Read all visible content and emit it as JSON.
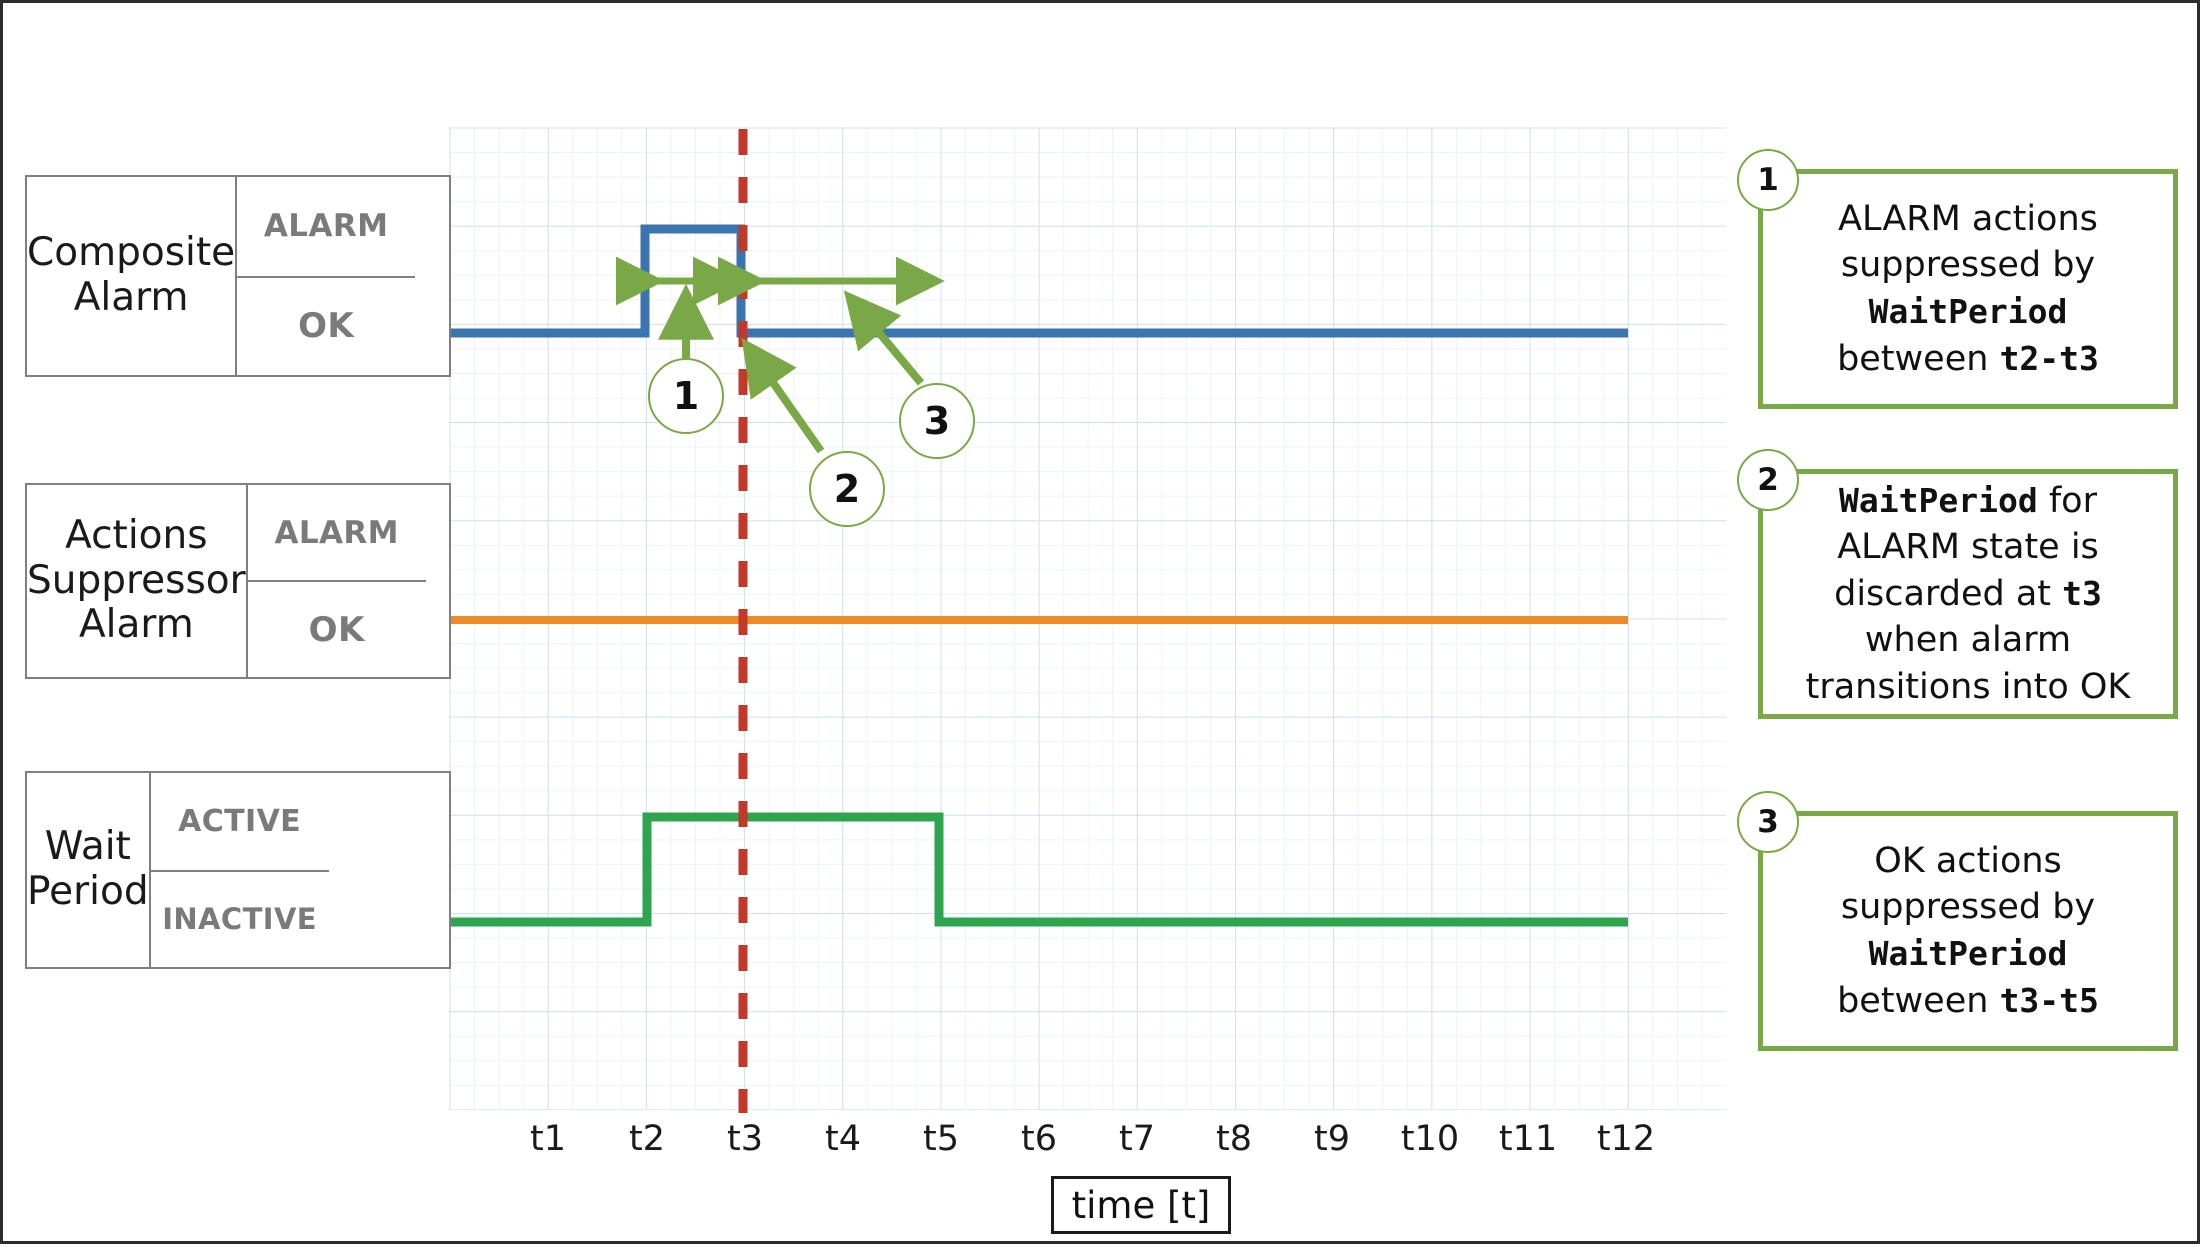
{
  "figure": {
    "axis_title": "time [t]",
    "x_ticks": [
      "t1",
      "t2",
      "t3",
      "t4",
      "t5",
      "t6",
      "t7",
      "t8",
      "t9",
      "t10",
      "t11",
      "t12"
    ]
  },
  "rows": [
    {
      "name": "Composite\nAlarm",
      "name_line1": "Composite",
      "name_line2": "Alarm",
      "state_high": "ALARM",
      "state_low": "OK",
      "color": "#3a75b0"
    },
    {
      "name": "Actions\nSuppressor\nAlarm",
      "name_line1": "Actions",
      "name_line2": "Suppressor",
      "name_line3": "Alarm",
      "state_high": "ALARM",
      "state_low": "OK",
      "color": "#ed8b29"
    },
    {
      "name": "Wait\nPeriod",
      "name_line1": "Wait",
      "name_line2": "Period",
      "state_high": "ACTIVE",
      "state_low": "INACTIVE",
      "color": "#2ea44f"
    }
  ],
  "markers": [
    {
      "id": "1"
    },
    {
      "id": "2"
    },
    {
      "id": "3"
    }
  ],
  "callouts": [
    {
      "id": "1",
      "line1": "ALARM actions",
      "line2": "suppressed by",
      "line3": "WaitPeriod",
      "line4_pre": "between ",
      "line4_mono": "t2-t3"
    },
    {
      "id": "2",
      "line1_mono": "WaitPeriod",
      "line1_post": " for",
      "line2": "ALARM state is",
      "line3_pre": "discarded at ",
      "line3_mono": "t3",
      "line4": "when alarm",
      "line5": "transitions into OK"
    },
    {
      "id": "3",
      "line1": "OK actions",
      "line2": "suppressed by",
      "line3": "WaitPeriod",
      "line4_pre": "between ",
      "line4_mono": "t3-t5"
    }
  ],
  "colors": {
    "composite_alarm": "#3a75b0",
    "suppressor_alarm": "#ed8b29",
    "wait_period": "#2ea44f",
    "marker_line": "#c0392b",
    "annotation": "#7aa846",
    "grid_major": "#cfe2f0",
    "grid_minor": "#eaf4fb",
    "box_border": "#808080"
  },
  "chart_data": {
    "type": "line",
    "title": "",
    "xlabel": "time [t]",
    "ylabel": "",
    "x": [
      "t1",
      "t2",
      "t3",
      "t4",
      "t5",
      "t6",
      "t7",
      "t8",
      "t9",
      "t10",
      "t11",
      "t12"
    ],
    "grid": true,
    "legend": "none",
    "marker_line_at": "t3",
    "series": [
      {
        "name": "Composite Alarm",
        "states": [
          "OK",
          "ALARM"
        ],
        "color": "#3a75b0",
        "steps": [
          {
            "from": "start",
            "to": "t2",
            "value": "OK"
          },
          {
            "from": "t2",
            "to": "t3",
            "value": "ALARM"
          },
          {
            "from": "t3",
            "to": "t12",
            "value": "OK"
          }
        ]
      },
      {
        "name": "Actions Suppressor Alarm",
        "states": [
          "OK",
          "ALARM"
        ],
        "color": "#ed8b29",
        "steps": [
          {
            "from": "start",
            "to": "t12",
            "value": "OK"
          }
        ]
      },
      {
        "name": "Wait Period",
        "states": [
          "INACTIVE",
          "ACTIVE"
        ],
        "color": "#2ea44f",
        "steps": [
          {
            "from": "start",
            "to": "t2",
            "value": "INACTIVE"
          },
          {
            "from": "t2",
            "to": "t5",
            "value": "ACTIVE"
          },
          {
            "from": "t5",
            "to": "t12",
            "value": "INACTIVE"
          }
        ]
      }
    ],
    "annotations": [
      {
        "id": "1",
        "span": [
          "t2",
          "t3"
        ],
        "note": "ALARM actions suppressed by WaitPeriod between t2-t3"
      },
      {
        "id": "2",
        "at": "t3",
        "note": "WaitPeriod for ALARM state is discarded at t3 when alarm transitions into OK"
      },
      {
        "id": "3",
        "span": [
          "t3",
          "t5"
        ],
        "note": "OK actions suppressed by WaitPeriod between t3-t5"
      }
    ]
  }
}
